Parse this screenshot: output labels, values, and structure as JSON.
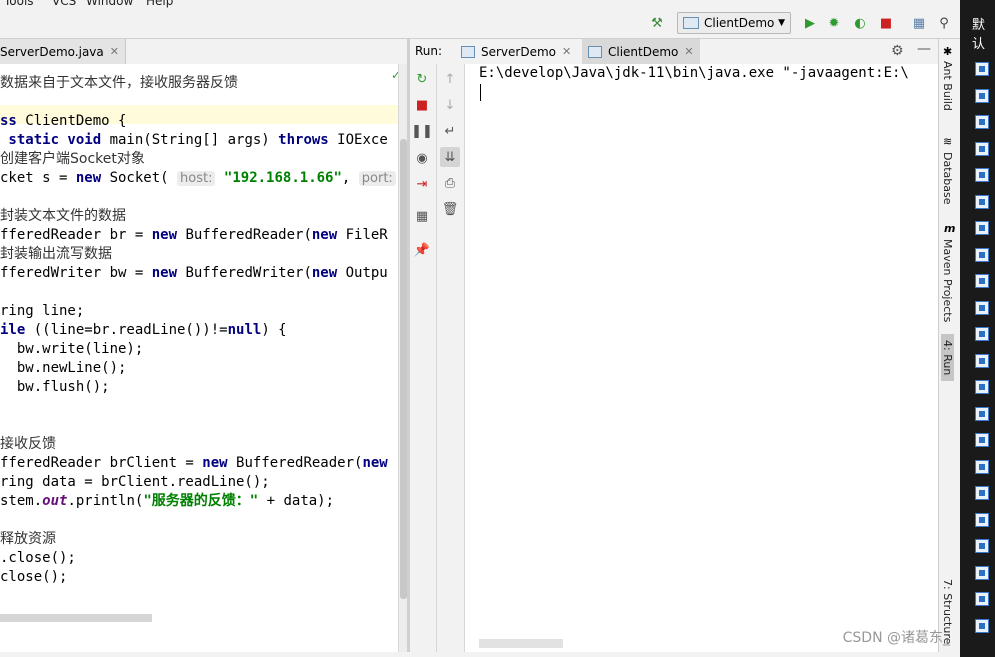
{
  "menu": {
    "items": [
      "Tools",
      "VCS",
      "Window",
      "Help"
    ]
  },
  "toolbar": {
    "run_config": "ClientDemo"
  },
  "editor": {
    "tab_label": "ServerDemo.java",
    "lines": [
      {
        "parts": [
          {
            "t": "数据来自于文本文件，接收服务器反馈",
            "c": "cm"
          }
        ]
      },
      {
        "parts": []
      },
      {
        "parts": [
          {
            "t": "ss ",
            "c": "kw"
          },
          {
            "t": "ClientDemo {",
            "c": ""
          }
        ]
      },
      {
        "parts": [
          {
            "t": " static void ",
            "c": "kw"
          },
          {
            "t": "main(String[] args) ",
            "c": ""
          },
          {
            "t": "throws ",
            "c": "kw"
          },
          {
            "t": "IOExce",
            "c": ""
          }
        ]
      },
      {
        "parts": [
          {
            "t": "创建客户端",
            "c": "cm"
          },
          {
            "t": "Socket",
            "c": "cm it2"
          },
          {
            "t": "对象",
            "c": "cm"
          }
        ]
      },
      {
        "parts": [
          {
            "t": "cket s = ",
            "c": ""
          },
          {
            "t": "new ",
            "c": "kw"
          },
          {
            "t": "Socket( ",
            "c": ""
          },
          {
            "t": "host:",
            "c": "hint"
          },
          {
            "t": " ",
            "c": ""
          },
          {
            "t": "\"192.168.1.66\"",
            "c": "str"
          },
          {
            "t": ", ",
            "c": ""
          },
          {
            "t": "port:",
            "c": "hint"
          }
        ]
      },
      {
        "parts": []
      },
      {
        "parts": [
          {
            "t": "封装文本文件的数据",
            "c": "cm"
          }
        ]
      },
      {
        "parts": [
          {
            "t": "fferedReader br = ",
            "c": ""
          },
          {
            "t": "new ",
            "c": "kw"
          },
          {
            "t": "BufferedReader(",
            "c": ""
          },
          {
            "t": "new ",
            "c": "kw"
          },
          {
            "t": "FileR",
            "c": ""
          }
        ]
      },
      {
        "parts": [
          {
            "t": "封装输出流写数据",
            "c": "cm"
          }
        ]
      },
      {
        "parts": [
          {
            "t": "fferedWriter bw = ",
            "c": ""
          },
          {
            "t": "new ",
            "c": "kw"
          },
          {
            "t": "BufferedWriter(",
            "c": ""
          },
          {
            "t": "new ",
            "c": "kw"
          },
          {
            "t": "Outpu",
            "c": ""
          }
        ]
      },
      {
        "parts": []
      },
      {
        "parts": [
          {
            "t": "ring line;",
            "c": ""
          }
        ]
      },
      {
        "parts": [
          {
            "t": "ile ",
            "c": "kw"
          },
          {
            "t": "((line=br.readLine())!=",
            "c": ""
          },
          {
            "t": "null",
            "c": "kw"
          },
          {
            "t": ") {",
            "c": ""
          }
        ]
      },
      {
        "parts": [
          {
            "t": "  bw.write(line);",
            "c": ""
          }
        ]
      },
      {
        "parts": [
          {
            "t": "  bw.newLine();",
            "c": ""
          }
        ]
      },
      {
        "parts": [
          {
            "t": "  bw.flush();",
            "c": ""
          }
        ]
      },
      {
        "parts": []
      },
      {
        "parts": []
      },
      {
        "parts": [
          {
            "t": "接收反馈",
            "c": "cm"
          }
        ]
      },
      {
        "parts": [
          {
            "t": "fferedReader brClient = ",
            "c": ""
          },
          {
            "t": "new ",
            "c": "kw"
          },
          {
            "t": "BufferedReader(",
            "c": ""
          },
          {
            "t": "new",
            "c": "kw"
          }
        ]
      },
      {
        "parts": [
          {
            "t": "ring data = brClient.readLine();",
            "c": ""
          }
        ]
      },
      {
        "parts": [
          {
            "t": "stem.",
            "c": ""
          },
          {
            "t": "out",
            "c": "it"
          },
          {
            "t": ".println(",
            "c": ""
          },
          {
            "t": "\"服务器的反馈：\"",
            "c": "str"
          },
          {
            "t": " + data);",
            "c": ""
          }
        ]
      },
      {
        "parts": []
      },
      {
        "parts": [
          {
            "t": "释放资源",
            "c": "cm"
          }
        ]
      },
      {
        "parts": [
          {
            "t": ".close();",
            "c": ""
          }
        ]
      },
      {
        "parts": [
          {
            "t": "close();",
            "c": ""
          }
        ]
      }
    ]
  },
  "run": {
    "label": "Run:",
    "tabs": [
      "ServerDemo",
      "ClientDemo"
    ],
    "console_line": "E:\\develop\\Java\\jdk-11\\bin\\java.exe \"-javaagent:E:\\"
  },
  "right_tools": [
    "Ant Build",
    "Database",
    "Maven Projects",
    "4: Run",
    "7: Structure"
  ],
  "taskbar": {
    "title": "默认"
  },
  "watermark": "CSDN @诸葛东_"
}
